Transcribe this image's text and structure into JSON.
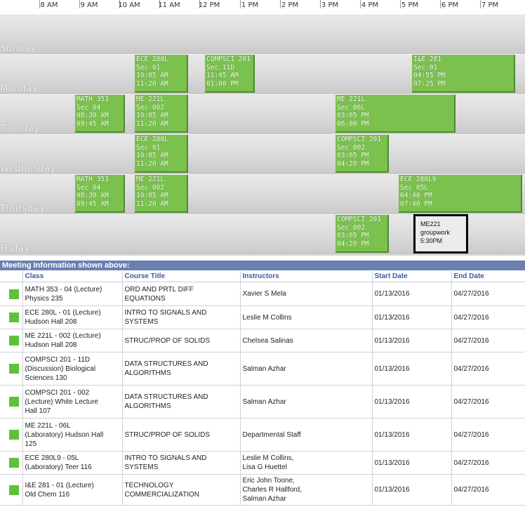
{
  "calendar": {
    "hours": [
      "8 AM",
      "9 AM",
      "10 AM",
      "11 AM",
      "12 PM",
      "1 PM",
      "2 PM",
      "3 PM",
      "4 PM",
      "5 PM",
      "6 PM",
      "7 PM"
    ],
    "days": [
      "Sunday",
      "Monday",
      "Tuesday",
      "Wednesday",
      "Thursday",
      "Friday"
    ],
    "events": [
      {
        "day": "Monday",
        "start": 10.0,
        "end": 11.333,
        "lines": [
          "ECE 280L",
          "Sec 01",
          "10:05 AM",
          "11:20 AM"
        ]
      },
      {
        "day": "Monday",
        "start": 11.75,
        "end": 13.0,
        "lines": [
          "COMPSCI 201",
          "Sec 11D",
          "11:45 AM",
          "01:00 PM"
        ]
      },
      {
        "day": "Monday",
        "start": 16.917,
        "end": 19.5,
        "lines": [
          "I&E 281",
          "Sec 01",
          "04:55 PM",
          "07:25 PM"
        ]
      },
      {
        "day": "Tuesday",
        "start": 8.5,
        "end": 9.75,
        "lines": [
          "MATH 353",
          "Sec 04",
          "08:30 AM",
          "09:45 AM"
        ]
      },
      {
        "day": "Tuesday",
        "start": 10.0,
        "end": 11.333,
        "lines": [
          "ME 221L",
          "Sec 002",
          "10:05 AM",
          "11:20 AM"
        ]
      },
      {
        "day": "Tuesday",
        "start": 15.0,
        "end": 18.0,
        "lines": [
          "ME 221L",
          "Sec 06L",
          "03:05 PM",
          "06:00 PM"
        ]
      },
      {
        "day": "Wednesday",
        "start": 10.0,
        "end": 11.333,
        "lines": [
          "ECE 280L",
          "Sec 01",
          "10:05 AM",
          "11:20 AM"
        ]
      },
      {
        "day": "Wednesday",
        "start": 15.0,
        "end": 16.333,
        "lines": [
          "COMPSCI 201",
          "Sec 002",
          "03:05 PM",
          "04:20 PM"
        ]
      },
      {
        "day": "Thursday",
        "start": 8.5,
        "end": 9.75,
        "lines": [
          "MATH 353",
          "Sec 04",
          "08:30 AM",
          "09:45 AM"
        ]
      },
      {
        "day": "Thursday",
        "start": 10.0,
        "end": 11.333,
        "lines": [
          "ME 221L",
          "Sec 002",
          "10:05 AM",
          "11:20 AM"
        ]
      },
      {
        "day": "Thursday",
        "start": 16.583,
        "end": 19.667,
        "lines": [
          "ECE 280L9",
          "Sec 05L",
          "04:40 PM",
          "07:40 PM"
        ]
      },
      {
        "day": "Friday",
        "start": 15.0,
        "end": 16.333,
        "lines": [
          "COMPSCI 201",
          "Sec 002",
          "03:05 PM",
          "04:20 PM"
        ]
      }
    ],
    "note": {
      "lines": [
        "ME221",
        "groupwork",
        "5:30PM"
      ]
    }
  },
  "meeting": {
    "title": "Meeting Information shown above:",
    "columns": [
      "",
      "Class",
      "Course Title",
      "Instructors",
      "Start Date",
      "End Date"
    ],
    "swatch_color": "#5ec236",
    "rows": [
      {
        "class": [
          "MATH 353 - 04 (Lecture)",
          "Physics 235"
        ],
        "title": [
          "ORD AND PRTL DIFF",
          "EQUATIONS"
        ],
        "instructors": [
          "Xavier S Mela"
        ],
        "start": "01/13/2016",
        "end": "04/27/2016"
      },
      {
        "class": [
          "ECE 280L - 01 (Lecture)",
          "Hudson Hall 208"
        ],
        "title": [
          "INTRO TO SIGNALS AND",
          "SYSTEMS"
        ],
        "instructors": [
          "Leslie M Collins"
        ],
        "start": "01/13/2016",
        "end": "04/27/2016"
      },
      {
        "class": [
          "ME 221L - 002 (Lecture)",
          "Hudson Hall 208"
        ],
        "title": [
          "STRUC/PROP OF SOLIDS"
        ],
        "instructors": [
          "Chelsea Salinas"
        ],
        "start": "01/13/2016",
        "end": "04/27/2016"
      },
      {
        "class": [
          "COMPSCI 201 - 11D",
          "(Discussion) Biological",
          "Sciences 130"
        ],
        "title": [
          "DATA STRUCTURES AND",
          "ALGORITHMS"
        ],
        "instructors": [
          "Salman Azhar"
        ],
        "start": "01/13/2016",
        "end": "04/27/2016"
      },
      {
        "class": [
          "COMPSCI 201 - 002",
          "(Lecture) White Lecture",
          "Hall 107"
        ],
        "title": [
          "DATA STRUCTURES AND",
          "ALGORITHMS"
        ],
        "instructors": [
          "Salman Azhar"
        ],
        "start": "01/13/2016",
        "end": "04/27/2016"
      },
      {
        "class": [
          "ME 221L - 06L",
          "(Laboratory) Hudson Hall",
          "125"
        ],
        "title": [
          "STRUC/PROP OF SOLIDS"
        ],
        "instructors": [
          "Departmental Staff"
        ],
        "start": "01/13/2016",
        "end": "04/27/2016"
      },
      {
        "class": [
          "ECE 280L9 - 05L",
          "(Laboratory) Teer 116"
        ],
        "title": [
          "INTRO TO SIGNALS AND",
          "SYSTEMS"
        ],
        "instructors": [
          "Leslie M Collins,",
          "Lisa G Huettel"
        ],
        "start": "01/13/2016",
        "end": "04/27/2016"
      },
      {
        "class": [
          "I&E 281 - 01 (Lecture)",
          "Old Chem 116"
        ],
        "title": [
          "TECHNOLOGY",
          "COMMERCIALIZATION"
        ],
        "instructors": [
          "Eric John Toone,",
          "Charles R Hallford,",
          "Salman Azhar"
        ],
        "start": "01/13/2016",
        "end": "04/27/2016"
      }
    ]
  }
}
